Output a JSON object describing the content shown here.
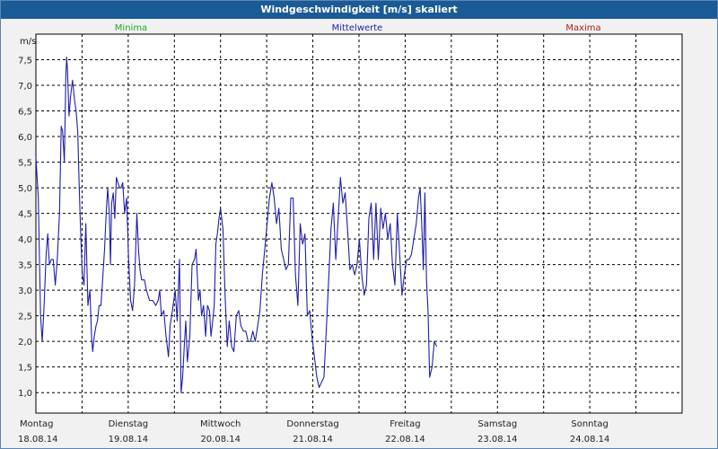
{
  "window": {
    "title": "Windgeschwindigkeit [m/s] skaliert"
  },
  "legend": [
    {
      "label": "Minima",
      "color": "#22aa22"
    },
    {
      "label": "Mittelwerte",
      "color": "#2222aa"
    },
    {
      "label": "Maxima",
      "color": "#aa2222"
    }
  ],
  "chart_data": {
    "type": "line",
    "title": "Windgeschwindigkeit [m/s] skaliert",
    "ylabel": "m/s",
    "ylim": [
      0.6,
      8.0
    ],
    "xlim": [
      0,
      7
    ],
    "grid": true,
    "yticks": [
      "1,0",
      "1,5",
      "2,0",
      "2,5",
      "3,0",
      "3,5",
      "4,0",
      "4,5",
      "5,0",
      "5,5",
      "6,0",
      "6,5",
      "7,0",
      "7,5"
    ],
    "xticks": [
      {
        "day": "Montag",
        "date": "18.08.14"
      },
      {
        "day": "Dienstag",
        "date": "19.08.14"
      },
      {
        "day": "Mittwoch",
        "date": "20.08.14"
      },
      {
        "day": "Donnerstag",
        "date": "21.08.14"
      },
      {
        "day": "Freitag",
        "date": "22.08.14"
      },
      {
        "day": "Samstag",
        "date": "23.08.14"
      },
      {
        "day": "Sonntag",
        "date": "24.08.14"
      }
    ],
    "series": [
      {
        "name": "Mittelwerte",
        "color": "#1f1fa8",
        "points": [
          [
            0.0,
            5.6
          ],
          [
            0.026,
            4.8
          ],
          [
            0.051,
            2.5
          ],
          [
            0.068,
            2.0
          ],
          [
            0.087,
            2.6
          ],
          [
            0.111,
            3.7
          ],
          [
            0.128,
            4.1
          ],
          [
            0.146,
            3.5
          ],
          [
            0.167,
            3.6
          ],
          [
            0.188,
            3.6
          ],
          [
            0.21,
            3.1
          ],
          [
            0.231,
            3.6
          ],
          [
            0.256,
            4.5
          ],
          [
            0.274,
            6.2
          ],
          [
            0.29,
            6.1
          ],
          [
            0.308,
            5.5
          ],
          [
            0.325,
            7.2
          ],
          [
            0.333,
            7.55
          ],
          [
            0.342,
            7.3
          ],
          [
            0.359,
            6.4
          ],
          [
            0.376,
            6.8
          ],
          [
            0.397,
            7.1
          ],
          [
            0.419,
            6.7
          ],
          [
            0.436,
            6.5
          ],
          [
            0.453,
            6.1
          ],
          [
            0.47,
            5.0
          ],
          [
            0.487,
            4.0
          ],
          [
            0.504,
            3.3
          ],
          [
            0.521,
            3.1
          ],
          [
            0.541,
            4.3
          ],
          [
            0.564,
            2.7
          ],
          [
            0.585,
            3.0
          ],
          [
            0.603,
            2.1
          ],
          [
            0.615,
            1.8
          ],
          [
            0.632,
            2.1
          ],
          [
            0.65,
            2.3
          ],
          [
            0.667,
            2.4
          ],
          [
            0.684,
            2.7
          ],
          [
            0.705,
            2.7
          ],
          [
            0.726,
            3.3
          ],
          [
            0.744,
            3.8
          ],
          [
            0.761,
            4.5
          ],
          [
            0.778,
            5.0
          ],
          [
            0.795,
            4.5
          ],
          [
            0.808,
            3.5
          ],
          [
            0.821,
            4.7
          ],
          [
            0.838,
            4.9
          ],
          [
            0.855,
            4.4
          ],
          [
            0.872,
            5.2
          ],
          [
            0.889,
            5.1
          ],
          [
            0.906,
            5.0
          ],
          [
            0.923,
            5.0
          ],
          [
            0.94,
            5.1
          ],
          [
            0.962,
            4.5
          ],
          [
            0.983,
            4.8
          ],
          [
            1.004,
            3.6
          ],
          [
            1.026,
            2.8
          ],
          [
            1.047,
            2.6
          ],
          [
            1.068,
            3.1
          ],
          [
            1.094,
            4.5
          ],
          [
            1.111,
            3.8
          ],
          [
            1.128,
            3.4
          ],
          [
            1.145,
            3.2
          ],
          [
            1.175,
            3.2
          ],
          [
            1.197,
            3.0
          ],
          [
            1.231,
            2.8
          ],
          [
            1.265,
            2.8
          ],
          [
            1.299,
            2.7
          ],
          [
            1.325,
            2.8
          ],
          [
            1.342,
            3.0
          ],
          [
            1.359,
            2.5
          ],
          [
            1.385,
            2.6
          ],
          [
            1.41,
            2.1
          ],
          [
            1.436,
            1.7
          ],
          [
            1.453,
            2.3
          ],
          [
            1.479,
            2.6
          ],
          [
            1.509,
            3.0
          ],
          [
            1.53,
            2.4
          ],
          [
            1.556,
            3.6
          ],
          [
            1.573,
            1.0
          ],
          [
            1.59,
            1.3
          ],
          [
            1.607,
            1.9
          ],
          [
            1.624,
            2.4
          ],
          [
            1.641,
            1.6
          ],
          [
            1.667,
            2.1
          ],
          [
            1.692,
            3.5
          ],
          [
            1.718,
            3.6
          ],
          [
            1.735,
            3.8
          ],
          [
            1.761,
            2.8
          ],
          [
            1.778,
            3.0
          ],
          [
            1.795,
            2.5
          ],
          [
            1.816,
            2.7
          ],
          [
            1.838,
            2.1
          ],
          [
            1.859,
            2.7
          ],
          [
            1.88,
            2.6
          ],
          [
            1.897,
            2.1
          ],
          [
            1.915,
            2.4
          ],
          [
            1.932,
            2.7
          ],
          [
            1.949,
            3.9
          ],
          [
            1.966,
            4.1
          ],
          [
            1.983,
            4.4
          ],
          [
            2.0,
            4.6
          ],
          [
            2.026,
            4.2
          ],
          [
            2.051,
            2.8
          ],
          [
            2.073,
            1.9
          ],
          [
            2.094,
            2.4
          ],
          [
            2.12,
            1.9
          ],
          [
            2.145,
            1.8
          ],
          [
            2.171,
            2.5
          ],
          [
            2.197,
            2.6
          ],
          [
            2.222,
            2.3
          ],
          [
            2.248,
            2.2
          ],
          [
            2.274,
            2.2
          ],
          [
            2.299,
            2.0
          ],
          [
            2.325,
            2.0
          ],
          [
            2.35,
            2.2
          ],
          [
            2.376,
            2.0
          ],
          [
            2.402,
            2.3
          ],
          [
            2.427,
            2.6
          ],
          [
            2.453,
            3.3
          ],
          [
            2.479,
            3.8
          ],
          [
            2.504,
            4.3
          ],
          [
            2.53,
            4.8
          ],
          [
            2.556,
            5.1
          ],
          [
            2.581,
            4.8
          ],
          [
            2.607,
            4.3
          ],
          [
            2.632,
            4.6
          ],
          [
            2.658,
            3.8
          ],
          [
            2.684,
            3.6
          ],
          [
            2.709,
            3.4
          ],
          [
            2.735,
            3.5
          ],
          [
            2.761,
            4.8
          ],
          [
            2.786,
            4.8
          ],
          [
            2.812,
            3.3
          ],
          [
            2.838,
            2.7
          ],
          [
            2.863,
            4.3
          ],
          [
            2.889,
            3.9
          ],
          [
            2.915,
            4.1
          ],
          [
            2.94,
            2.5
          ],
          [
            2.966,
            2.6
          ],
          [
            2.991,
            2.1
          ],
          [
            3.017,
            1.7
          ],
          [
            3.043,
            1.3
          ],
          [
            3.068,
            1.1
          ],
          [
            3.094,
            1.2
          ],
          [
            3.12,
            1.3
          ],
          [
            3.145,
            2.2
          ],
          [
            3.171,
            3.2
          ],
          [
            3.197,
            4.2
          ],
          [
            3.222,
            4.7
          ],
          [
            3.248,
            3.6
          ],
          [
            3.274,
            4.4
          ],
          [
            3.299,
            5.2
          ],
          [
            3.325,
            4.7
          ],
          [
            3.35,
            4.9
          ],
          [
            3.376,
            4.2
          ],
          [
            3.402,
            3.4
          ],
          [
            3.427,
            3.5
          ],
          [
            3.453,
            3.3
          ],
          [
            3.479,
            3.5
          ],
          [
            3.504,
            4.0
          ],
          [
            3.53,
            3.3
          ],
          [
            3.556,
            2.9
          ],
          [
            3.581,
            3.1
          ],
          [
            3.607,
            4.4
          ],
          [
            3.632,
            4.7
          ],
          [
            3.658,
            3.6
          ],
          [
            3.684,
            4.7
          ],
          [
            3.709,
            3.6
          ],
          [
            3.735,
            4.6
          ],
          [
            3.761,
            4.2
          ],
          [
            3.786,
            4.5
          ],
          [
            3.812,
            4.0
          ],
          [
            3.838,
            4.3
          ],
          [
            3.863,
            3.5
          ],
          [
            3.889,
            3.1
          ],
          [
            3.915,
            4.5
          ],
          [
            3.94,
            3.7
          ],
          [
            3.966,
            2.9
          ],
          [
            3.991,
            3.3
          ],
          [
            4.017,
            3.6
          ],
          [
            4.043,
            3.6
          ],
          [
            4.068,
            3.7
          ],
          [
            4.094,
            4.0
          ],
          [
            4.12,
            4.3
          ],
          [
            4.145,
            4.8
          ],
          [
            4.162,
            5.0
          ],
          [
            4.18,
            4.3
          ],
          [
            4.197,
            3.4
          ],
          [
            4.214,
            4.9
          ],
          [
            4.231,
            3.2
          ],
          [
            4.248,
            2.6
          ],
          [
            4.265,
            1.3
          ],
          [
            4.291,
            1.5
          ],
          [
            4.316,
            2.0
          ],
          [
            4.342,
            1.9
          ]
        ]
      }
    ]
  }
}
